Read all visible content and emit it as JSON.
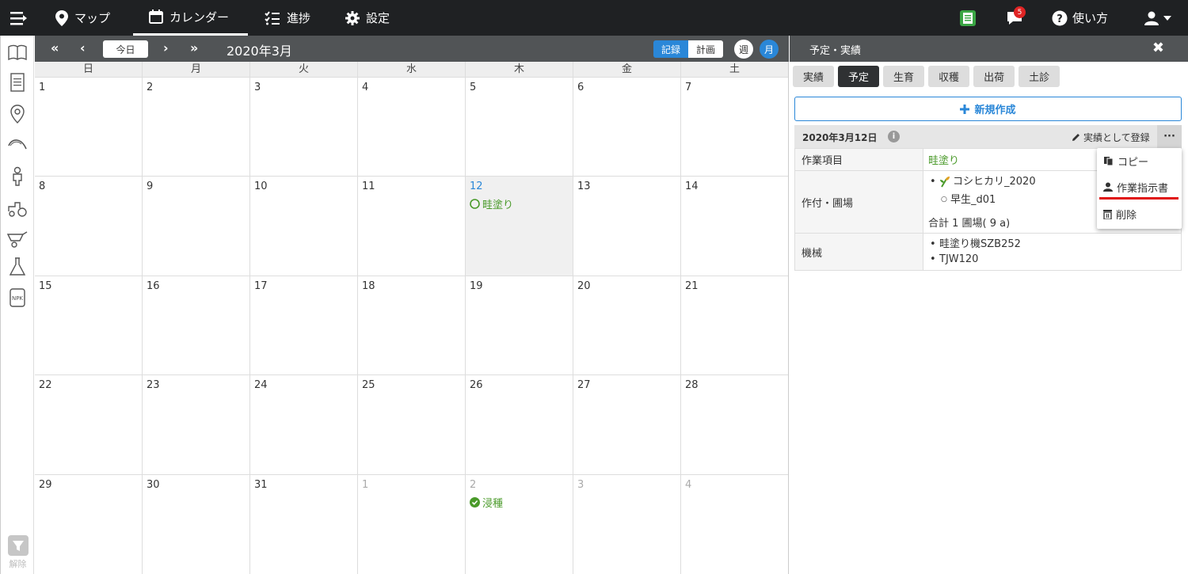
{
  "navbar": {
    "items": [
      {
        "label": "マップ",
        "icon": "map-pin-icon"
      },
      {
        "label": "カレンダー",
        "icon": "calendar-icon",
        "active": true
      },
      {
        "label": "進捗",
        "icon": "checklist-icon"
      },
      {
        "label": "設定",
        "icon": "gear-icon"
      }
    ],
    "notification_count": "5",
    "help_label": "使い方"
  },
  "sidebar": {
    "filter_label": "解除"
  },
  "calendar": {
    "today_label": "今日",
    "month_title": "2020年3月",
    "record_label": "記録",
    "plan_label": "計画",
    "week_label": "週",
    "month_label": "月",
    "days_of_week": [
      "日",
      "月",
      "火",
      "水",
      "木",
      "金",
      "土"
    ],
    "weeks": [
      [
        "1",
        "2",
        "3",
        "4",
        "5",
        "6",
        "7"
      ],
      [
        "8",
        "9",
        "10",
        "11",
        "12",
        "13",
        "14"
      ],
      [
        "15",
        "16",
        "17",
        "18",
        "19",
        "20",
        "21"
      ],
      [
        "22",
        "23",
        "24",
        "25",
        "26",
        "27",
        "28"
      ],
      [
        "29",
        "30",
        "31",
        "1",
        "2",
        "3",
        "4"
      ]
    ],
    "events": {
      "mar12": "畦塗り",
      "apr2": "浸種"
    }
  },
  "panel": {
    "title": "予定・実績",
    "tabs": [
      "実績",
      "予定",
      "生育",
      "収穫",
      "出荷",
      "土診"
    ],
    "new_button": "新規作成",
    "record_date": "2020年3月12日",
    "register_label": "実績として登録",
    "rows": {
      "work_item_label": "作業項目",
      "work_item_value": "畦塗り",
      "crop_label": "作付・圃場",
      "crop_name": "コシヒカリ_2020",
      "field_name": "早生_d01",
      "total": "合計 1 圃場( 9 a)",
      "machine_label": "機械",
      "machines": [
        "畦塗り機SZB252",
        "TJW120"
      ]
    }
  },
  "dropdown": {
    "copy": "コピー",
    "instruction": "作業指示書",
    "delete": "削除"
  },
  "colors": {
    "accent": "#2a87d8",
    "event_green": "#4a9a2a",
    "navbar": "#1f2123",
    "toolbar": "#515456"
  }
}
